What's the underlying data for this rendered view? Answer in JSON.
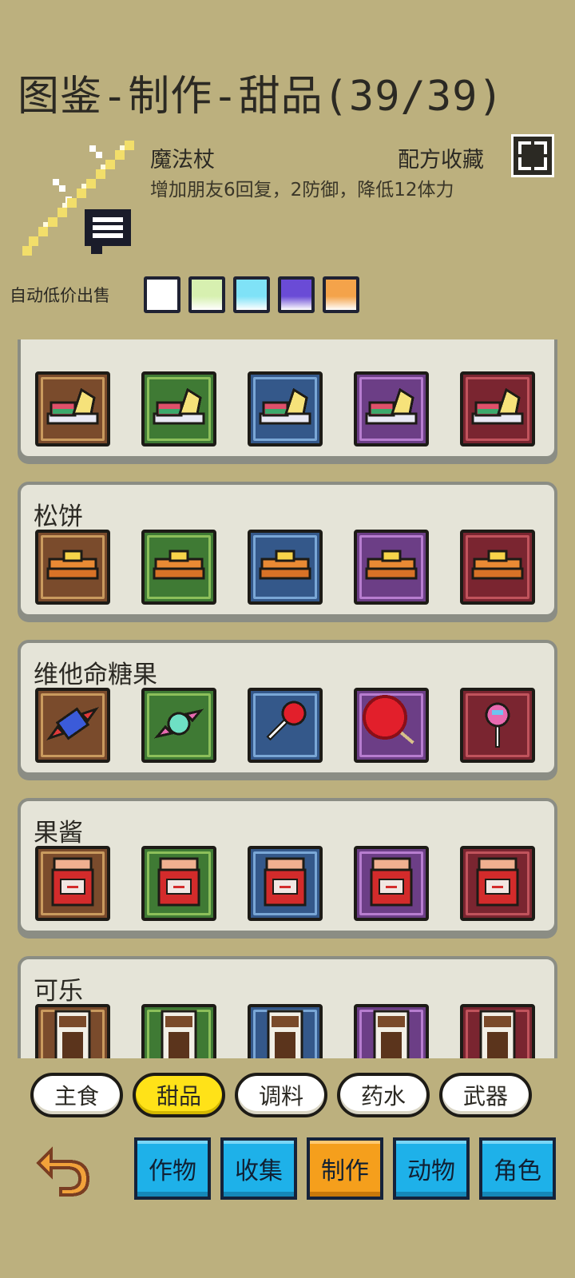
{
  "header": {
    "title": "图鉴-制作-甜品(39/39)"
  },
  "selected": {
    "name": "魔法杖",
    "description": "增加朋友6回复，2防御，降低12体力",
    "fav_label": "配方收藏"
  },
  "auto_sell": {
    "label": "自动低价出售",
    "swatches": [
      "#ffffff",
      "#d7f0b0",
      "#7fe2f7",
      "#6a4bd6",
      "#f4a34a"
    ]
  },
  "recipes": [
    {
      "title": "",
      "icon": "fruit-cake-icon"
    },
    {
      "title": "松饼",
      "icon": "pancake-icon"
    },
    {
      "title": "维他命糖果",
      "icon": "candy-icon"
    },
    {
      "title": "果酱",
      "icon": "jam-jar-icon"
    },
    {
      "title": "可乐",
      "icon": "cola-icon"
    }
  ],
  "category_tabs": [
    {
      "label": "主食",
      "active": false
    },
    {
      "label": "甜品",
      "active": true
    },
    {
      "label": "调料",
      "active": false
    },
    {
      "label": "药水",
      "active": false
    },
    {
      "label": "武器",
      "active": false
    }
  ],
  "main_tabs": [
    {
      "label": "作物",
      "active": false
    },
    {
      "label": "收集",
      "active": false
    },
    {
      "label": "制作",
      "active": true
    },
    {
      "label": "动物",
      "active": false
    },
    {
      "label": "角色",
      "active": false
    }
  ],
  "colors": {
    "background": "#bcb07e",
    "active_category": "#ffe218",
    "main_tab": "#1eb1e9",
    "main_tab_active": "#f59f1c"
  }
}
